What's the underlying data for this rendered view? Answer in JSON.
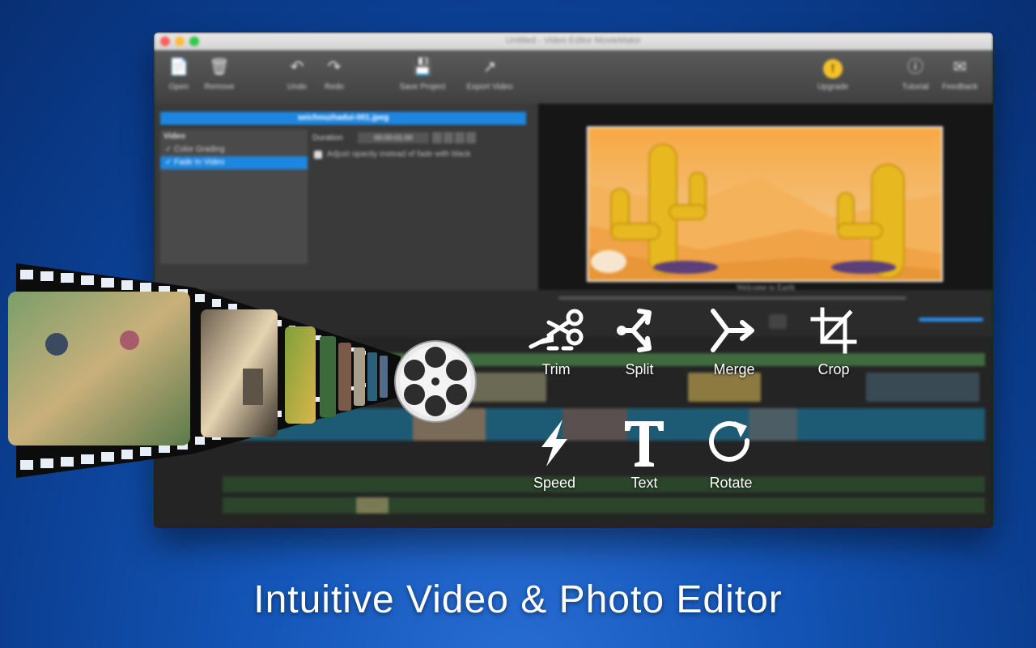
{
  "window": {
    "title": "Untitled - Video Editor MovieMator",
    "traffic_light_colors": [
      "#fc605b",
      "#fdbc40",
      "#34c84a"
    ]
  },
  "toolbar": {
    "open": "Open",
    "remove": "Remove",
    "undo": "Undo",
    "redo": "Redo",
    "save_project": "Save Project",
    "export_video": "Export Video",
    "upgrade": "Upgrade",
    "tutorial": "Tutorial",
    "feedback": "Feedback"
  },
  "filters_panel": {
    "file_name": "seichouzhadui-001.jpeg",
    "category": "Video",
    "items": [
      "Color Grading",
      "Fade In Video"
    ],
    "selected_index": 1,
    "duration_label": "Duration",
    "duration_value": "00:00:01:00",
    "option_label": "Adjust opacity instead of fade with black"
  },
  "preview": {
    "caption": "Welcome to Earth"
  },
  "features": [
    {
      "label": "Trim",
      "icon": "scissors-icon"
    },
    {
      "label": "Split",
      "icon": "split-icon"
    },
    {
      "label": "Merge",
      "icon": "merge-icon"
    },
    {
      "label": "Crop",
      "icon": "crop-icon"
    },
    {
      "label": "Speed",
      "icon": "lightning-icon"
    },
    {
      "label": "Text",
      "icon": "text-icon"
    },
    {
      "label": "Rotate",
      "icon": "rotate-icon"
    }
  ],
  "tagline": "Intuitive Video & Photo Editor",
  "colors": {
    "accent_blue": "#1d86e0",
    "background_blue": "#1456b8",
    "upgrade_gold": "#f4c12a",
    "icon_white": "#ffffff"
  }
}
